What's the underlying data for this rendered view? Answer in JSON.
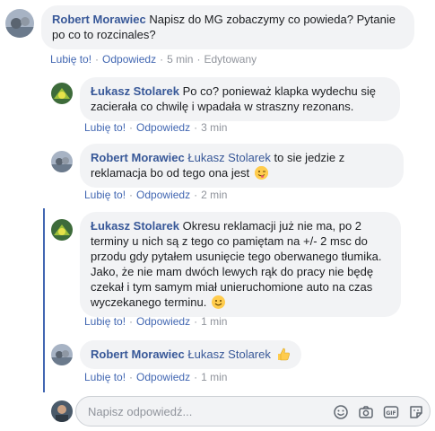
{
  "comments": [
    {
      "author": "Robert Morawiec",
      "text": "Napisz do MG zobaczymy co powieda? Pytanie po co to rozcinales?",
      "actions": {
        "like": "Lubię to!",
        "reply": "Odpowiedz",
        "time": "5 min",
        "edited": "Edytowany"
      }
    }
  ],
  "replies": [
    {
      "author": "Łukasz Stolarek",
      "text": "Po co? ponieważ klapka wydechu się zacierała co chwilę i wpadała w straszny rezonans.",
      "actions": {
        "like": "Lubię to!",
        "reply": "Odpowiedz",
        "time": "3 min"
      }
    },
    {
      "author": "Robert Morawiec",
      "mention": "Łukasz Stolarek",
      "text": "to sie jedzie z reklamacja bo od tego ona jest",
      "emoji": "winking-tongue-emoji",
      "actions": {
        "like": "Lubię to!",
        "reply": "Odpowiedz",
        "time": "2 min"
      }
    },
    {
      "author": "Łukasz Stolarek",
      "text": "Okresu reklamacji już nie ma, po 2 terminy u nich są z tego co pamiętam na +/- 2 msc do przodu gdy pytałem usunięcie tego oberwanego tłumika. Jako, że nie mam dwóch lewych rąk do pracy nie będę czekał i tym samym miał unieruchomione auto na czas wyczekanego terminu.",
      "emoji": "smile-emoji",
      "actions": {
        "like": "Lubię to!",
        "reply": "Odpowiedz",
        "time": "1 min"
      }
    },
    {
      "author": "Robert Morawiec",
      "mention": "Łukasz Stolarek",
      "emoji": "thumbs-up-emoji",
      "actions": {
        "like": "Lubię to!",
        "reply": "Odpowiedz",
        "time": "1 min"
      }
    }
  ],
  "reply_box": {
    "placeholder": "Napisz odpowiedź..."
  },
  "tools": [
    "emoji-icon",
    "camera-icon",
    "gif-icon",
    "sticker-icon"
  ],
  "colors": {
    "link": "#385898",
    "action_link": "#4267b2",
    "bubble": "#f2f3f5",
    "thread_line": "#4267b2"
  }
}
